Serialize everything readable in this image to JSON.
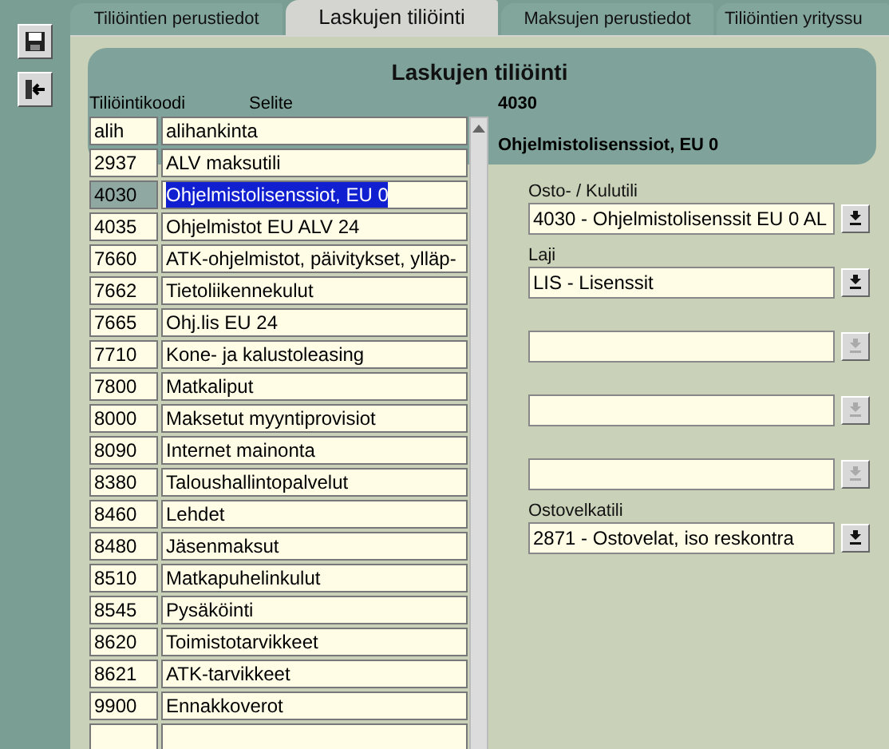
{
  "toolbar": [
    {
      "kind": "save"
    },
    {
      "kind": "exit"
    }
  ],
  "tabs": [
    {
      "label": "Tiliöintien perustiedot",
      "selected": false
    },
    {
      "label": "Laskujen tiliöinti",
      "selected": true
    },
    {
      "label": "Maksujen perustiedot",
      "selected": false
    },
    {
      "label": "Tiliöintien yrityssu",
      "selected": false
    }
  ],
  "panel": {
    "title": "Laskujen tiliöinti"
  },
  "columns": [
    "Tiliöintikoodi",
    "Selite"
  ],
  "rows": [
    {
      "code": "alih",
      "description": "alihankinta",
      "selected": false
    },
    {
      "code": "2937",
      "description": "ALV maksutili",
      "selected": false
    },
    {
      "code": "4030",
      "description": "Ohjelmistolisenssiot, EU 0",
      "selected": true
    },
    {
      "code": "4035",
      "description": "Ohjelmistot EU ALV 24",
      "selected": false
    },
    {
      "code": "7660",
      "description": "ATK-ohjelmistot, päivitykset, ylläp-",
      "selected": false
    },
    {
      "code": "7662",
      "description": "Tietoliikennekulut",
      "selected": false
    },
    {
      "code": "7665",
      "description": "Ohj.lis EU 24",
      "selected": false
    },
    {
      "code": "7710",
      "description": "Kone- ja kalustoleasing",
      "selected": false
    },
    {
      "code": "7800",
      "description": "Matkaliput",
      "selected": false
    },
    {
      "code": "8000",
      "description": "Maksetut myyntiprovisiot",
      "selected": false
    },
    {
      "code": "8090",
      "description": "Internet mainonta",
      "selected": false
    },
    {
      "code": "8380",
      "description": "Taloushallintopalvelut",
      "selected": false
    },
    {
      "code": "8460",
      "description": "Lehdet",
      "selected": false
    },
    {
      "code": "8480",
      "description": "Jäsenmaksut",
      "selected": false
    },
    {
      "code": "8510",
      "description": "Matkapuhelinkulut",
      "selected": false
    },
    {
      "code": "8545",
      "description": "Pysäköinti",
      "selected": false
    },
    {
      "code": "8620",
      "description": "Toimistotarvikkeet",
      "selected": false
    },
    {
      "code": "8621",
      "description": "ATK-tarvikkeet",
      "selected": false
    },
    {
      "code": "9900",
      "description": "Ennakkoverot",
      "selected": false
    }
  ],
  "detail": {
    "code": "4030",
    "name": "Ohjelmistolisenssiot, EU 0"
  },
  "fields": [
    {
      "label": "Osto- / Kulutili",
      "value": "4030 - Ohjelmistolisenssit EU 0 AL",
      "disabled": false
    },
    {
      "label": "Laji",
      "value": "LIS - Lisenssit",
      "disabled": false
    },
    {
      "disabled": true
    },
    {
      "disabled": true
    },
    {
      "disabled": true
    },
    {
      "label": "Ostovelkatili",
      "value": "2871 - Ostovelat, iso reskontra",
      "disabled": false
    }
  ]
}
